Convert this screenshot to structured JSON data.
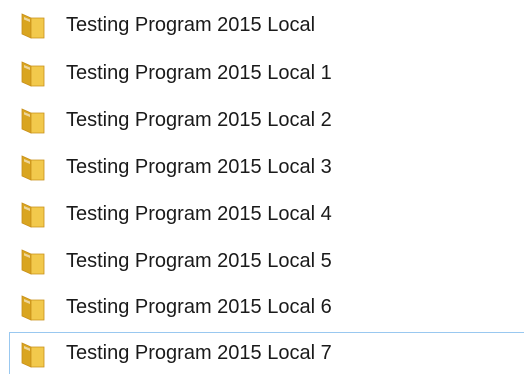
{
  "items": [
    {
      "name": "Testing Program 2015 Local",
      "icon": "folder-icon",
      "selected": false
    },
    {
      "name": "Testing Program 2015 Local 1",
      "icon": "folder-icon",
      "selected": false
    },
    {
      "name": "Testing Program 2015 Local 2",
      "icon": "folder-icon",
      "selected": false
    },
    {
      "name": "Testing Program 2015 Local 3",
      "icon": "folder-icon",
      "selected": false
    },
    {
      "name": "Testing Program 2015 Local 4",
      "icon": "folder-icon",
      "selected": false
    },
    {
      "name": "Testing Program 2015 Local 5",
      "icon": "folder-icon",
      "selected": false
    },
    {
      "name": "Testing Program 2015 Local 6",
      "icon": "folder-icon",
      "selected": false
    },
    {
      "name": "Testing Program 2015 Local 7",
      "icon": "folder-icon",
      "selected": true
    }
  ],
  "colors": {
    "folder_body": "#f2c94c",
    "folder_dark": "#d9a520",
    "folder_edge": "#c8901a",
    "selection_border": "#99c8f0",
    "text": "#1a1a1a"
  }
}
